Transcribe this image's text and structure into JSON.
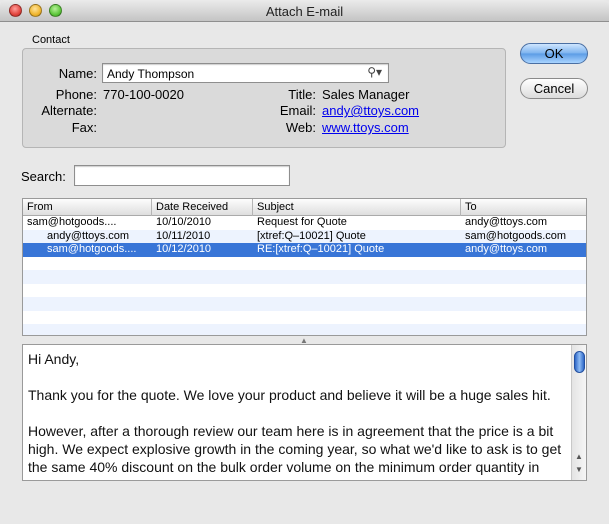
{
  "window": {
    "title": "Attach E-mail"
  },
  "contact": {
    "group_label": "Contact",
    "name_label": "Name:",
    "name_value": "Andy Thompson",
    "phone_label": "Phone:",
    "phone_value": "770-100-0020",
    "alternate_label": "Alternate:",
    "fax_label": "Fax:",
    "title_label": "Title:",
    "title_value": "Sales Manager",
    "email_label": "Email:",
    "email_value": "andy@ttoys.com",
    "web_label": "Web:",
    "web_value": "www.ttoys.com"
  },
  "buttons": {
    "ok": "OK",
    "cancel": "Cancel"
  },
  "search": {
    "label": "Search:",
    "value": ""
  },
  "table": {
    "columns": [
      "From",
      "Date Received",
      "Subject",
      "To"
    ],
    "rows": [
      {
        "from": "sam@hotgoods....",
        "date": "10/10/2010",
        "subject": "Request for Quote",
        "to": "andy@ttoys.com"
      },
      {
        "from": "andy@ttoys.com",
        "date": "10/11/2010",
        "subject": "[xtref:Q–10021] Quote",
        "to": "sam@hotgoods.com"
      },
      {
        "from": "sam@hotgoods....",
        "date": "10/12/2010",
        "subject": "RE:[xtref:Q–10021] Quote",
        "to": "andy@ttoys.com"
      }
    ],
    "selected_row": 2
  },
  "message": {
    "greeting": "Hi Andy,",
    "para1": "Thank you for the quote.  We love your product and believe it will be a huge sales hit.",
    "para2": "However, after a thorough review our team here is in agreement that the price is a bit high.   We expect explosive growth in the coming year, so what we'd like to ask is to get the same 40% discount on the bulk order volume on the minimum order quantity in antcipation of our future sales increases.  Since our company will soon be a"
  },
  "icons": {
    "name_lookup": "magnifier-dropdown-icon",
    "window_controls": [
      "close-icon",
      "minimize-icon",
      "zoom-icon"
    ]
  },
  "colors": {
    "selection": "#3875d7",
    "link": "#0000ee",
    "default_button": "#5a9be5"
  }
}
